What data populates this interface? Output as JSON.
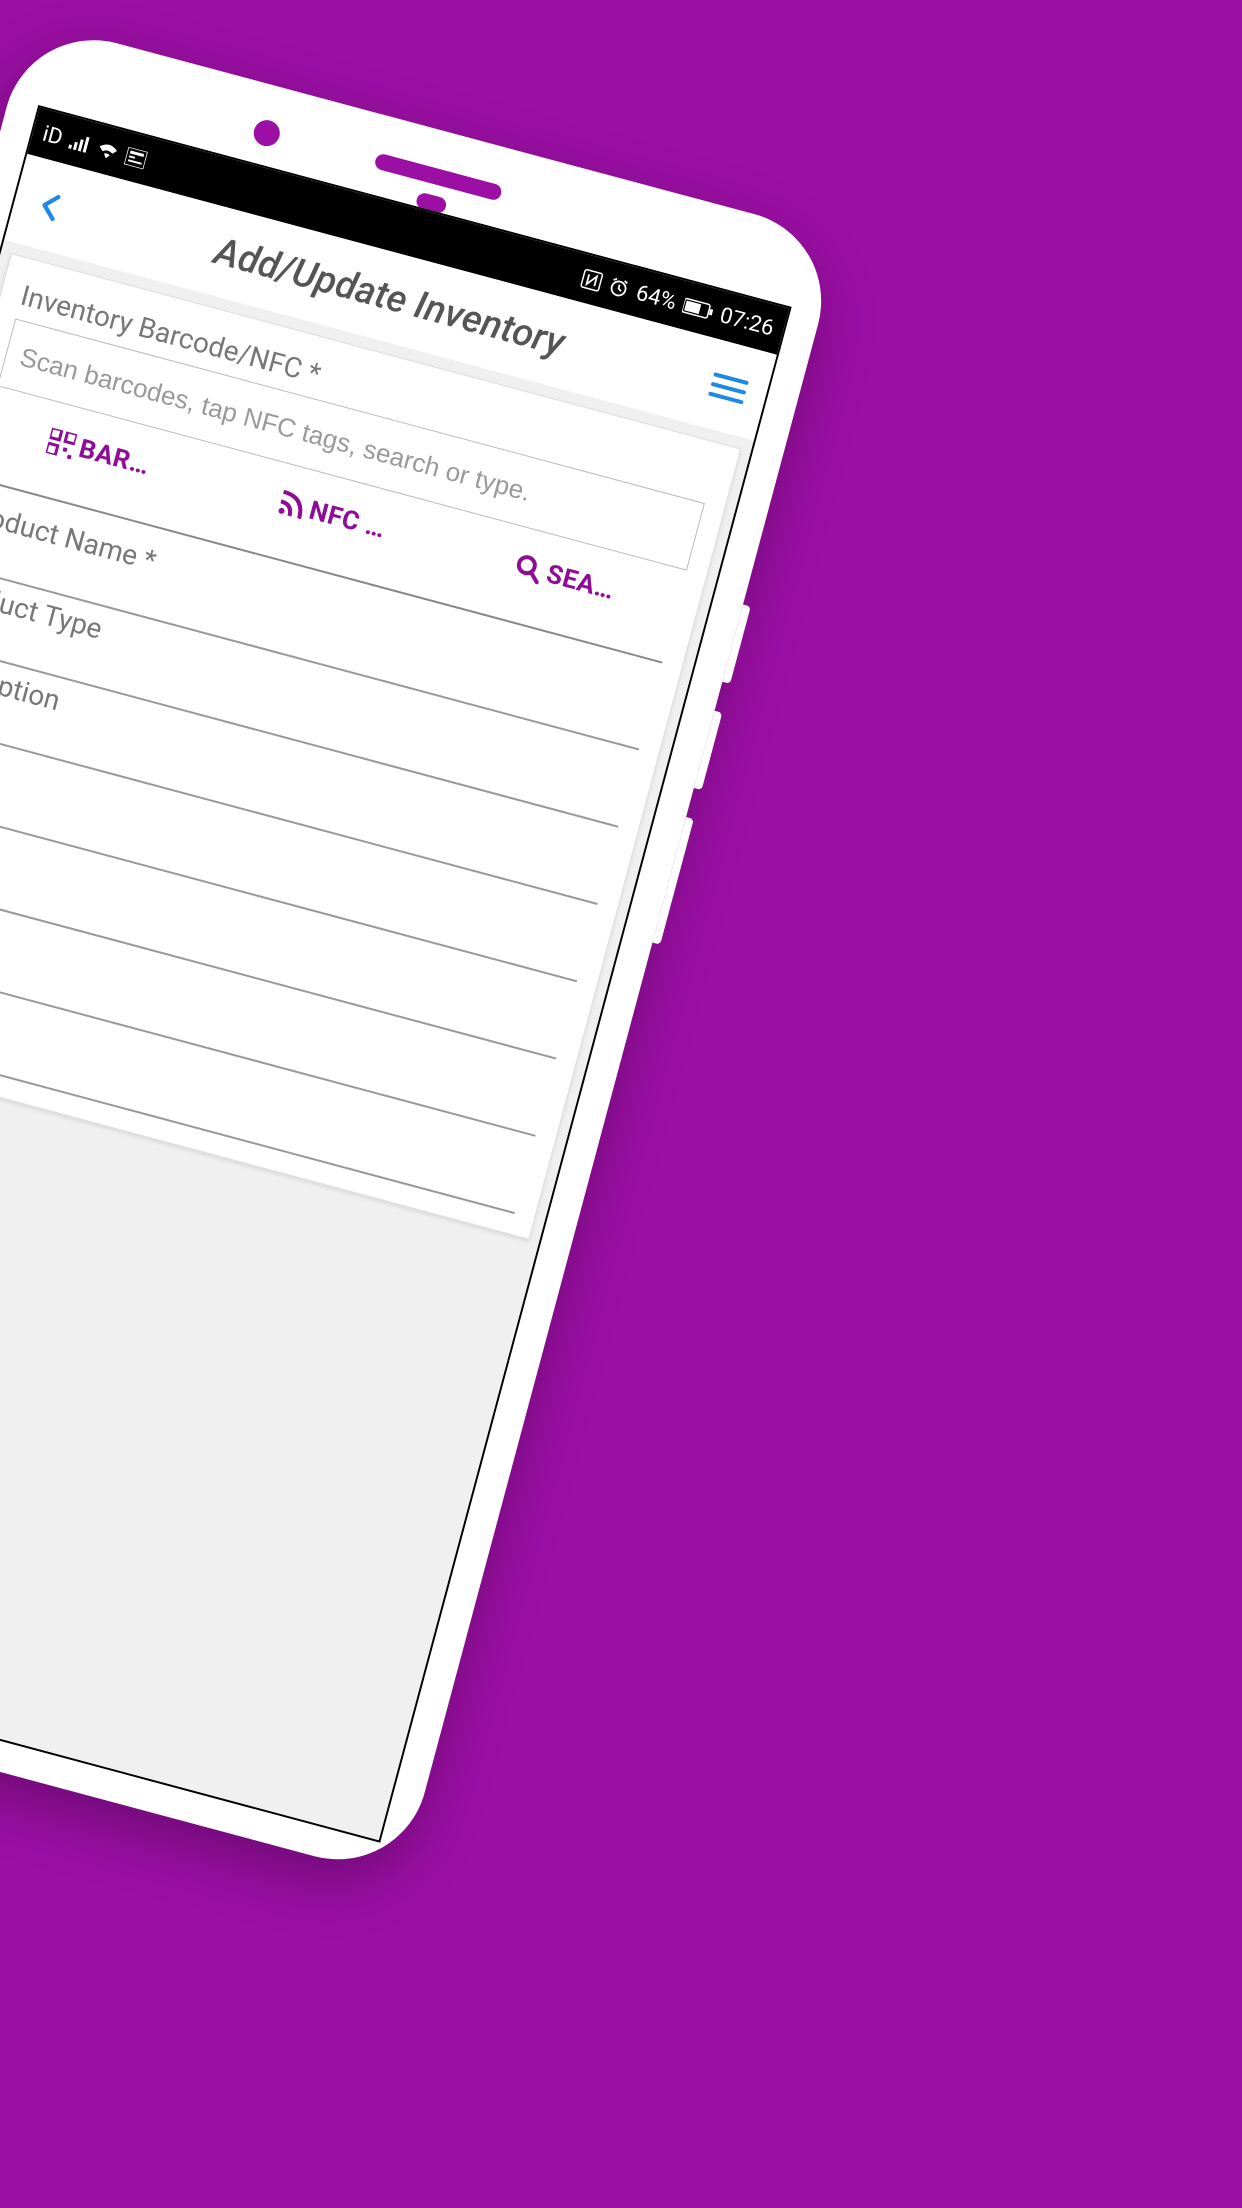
{
  "status_bar": {
    "carrier": "iD",
    "battery_text": "64%",
    "time": "07:26"
  },
  "header": {
    "title": "Add/Update Inventory"
  },
  "form": {
    "barcode_label": "Inventory Barcode/NFC *",
    "barcode_placeholder": "Scan barcodes, tap NFC tags, search or type.",
    "actions": {
      "barcode": "BAR…",
      "nfc": "NFC …",
      "search": "SEA…"
    },
    "product_name_label": "Product Name *",
    "product_type_label": "Product Type",
    "description_label": "Description"
  },
  "colors": {
    "brand": "#9c0fa5",
    "link": "#1e88e5"
  }
}
